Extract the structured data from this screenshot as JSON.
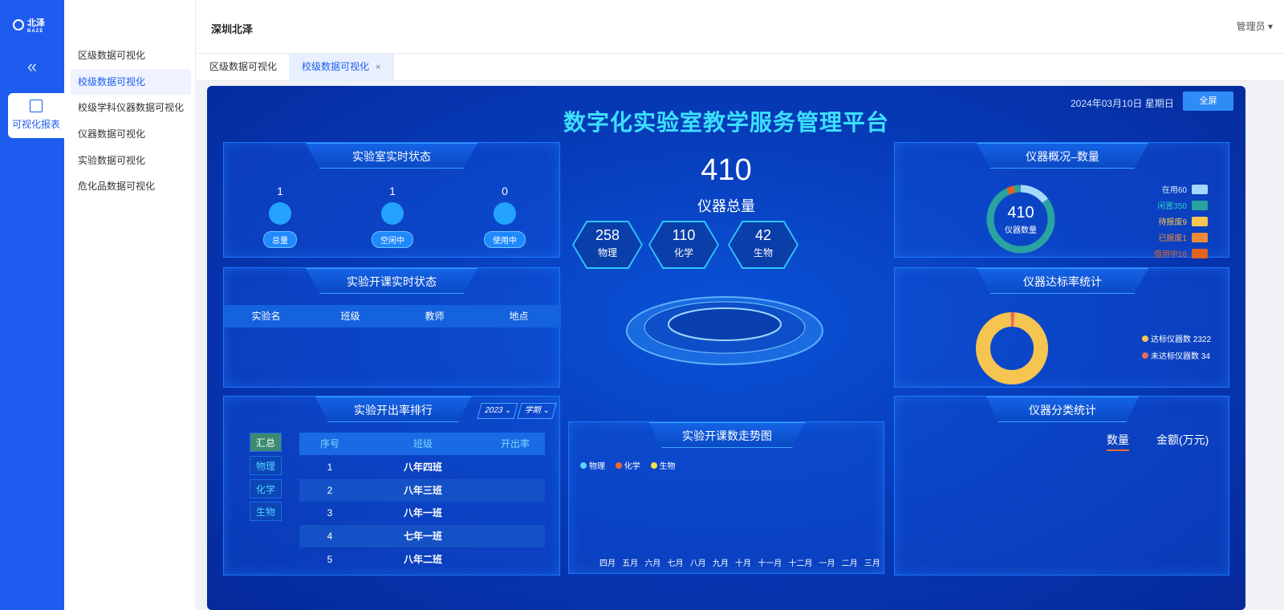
{
  "app": {
    "logo_text": "北泽",
    "logo_sub": "BAZE",
    "collapse_icon": "«",
    "nav_active": "可视化报表"
  },
  "submenu": [
    "区级数据可视化",
    "校级数据可视化",
    "校级学科仪器数据可视化",
    "仪器数据可视化",
    "实验数据可视化",
    "危化品数据可视化"
  ],
  "topbar": {
    "title": "深圳北泽",
    "user": "管理员 ▾"
  },
  "tabs": [
    {
      "label": "区级数据可视化"
    },
    {
      "label": "校级数据可视化",
      "close": "×"
    }
  ],
  "dash": {
    "title": "数字化实验室教学服务管理平台",
    "date": "2024年03月10日 星期日",
    "fullscreen": "全屏",
    "realtime": {
      "title": "实验室实时状态",
      "items": [
        {
          "n": "1",
          "label": "总量"
        },
        {
          "n": "1",
          "label": "空闲中"
        },
        {
          "n": "0",
          "label": "使用中"
        }
      ]
    },
    "course_status": {
      "title": "实验开课实时状态",
      "cols": [
        "实验名",
        "班级",
        "教师",
        "地点"
      ]
    },
    "ranking": {
      "title": "实验开出率排行",
      "year": "2023",
      "term": "学期",
      "buttons": [
        "汇总",
        "物理",
        "化学",
        "生物"
      ],
      "cols": [
        "序号",
        "班级",
        "开出率"
      ],
      "rows": [
        [
          "1",
          "八年四班"
        ],
        [
          "2",
          "八年三班"
        ],
        [
          "3",
          "八年一班"
        ],
        [
          "4",
          "七年一班"
        ],
        [
          "5",
          "八年二班"
        ]
      ]
    },
    "center": {
      "total": "410",
      "total_label": "仪器总量",
      "subjects": [
        {
          "v": "258",
          "l": "物理"
        },
        {
          "v": "110",
          "l": "化学"
        },
        {
          "v": "42",
          "l": "生物"
        }
      ]
    },
    "trend": {
      "title": "实验开课数走势图",
      "legend": [
        "物理",
        "化学",
        "生物"
      ],
      "months": [
        "四月",
        "五月",
        "六月",
        "七月",
        "八月",
        "九月",
        "十月",
        "十一月",
        "十二月",
        "一月",
        "二月",
        "三月"
      ]
    },
    "overview": {
      "title": "仪器概况–数量",
      "center_value": "410",
      "center_label": "仪器数量",
      "legend": [
        {
          "t": "在用60",
          "c": "#a6d8ff"
        },
        {
          "t": "闲置350",
          "c": "#2aa3a0"
        },
        {
          "t": "待报废9",
          "c": "#f5c451"
        },
        {
          "t": "已报废1",
          "c": "#f08a3a"
        },
        {
          "t": "借用中16",
          "c": "#e2621f"
        }
      ]
    },
    "standard": {
      "title": "仪器达标率统计",
      "legend": [
        {
          "t": "达标仪器数 2322",
          "c": "#f5c451"
        },
        {
          "t": "未达标仪器数 34",
          "c": "#e86a5b"
        }
      ]
    },
    "category": {
      "title": "仪器分类统计",
      "tabs": [
        "数量",
        "金额(万元)"
      ]
    }
  }
}
